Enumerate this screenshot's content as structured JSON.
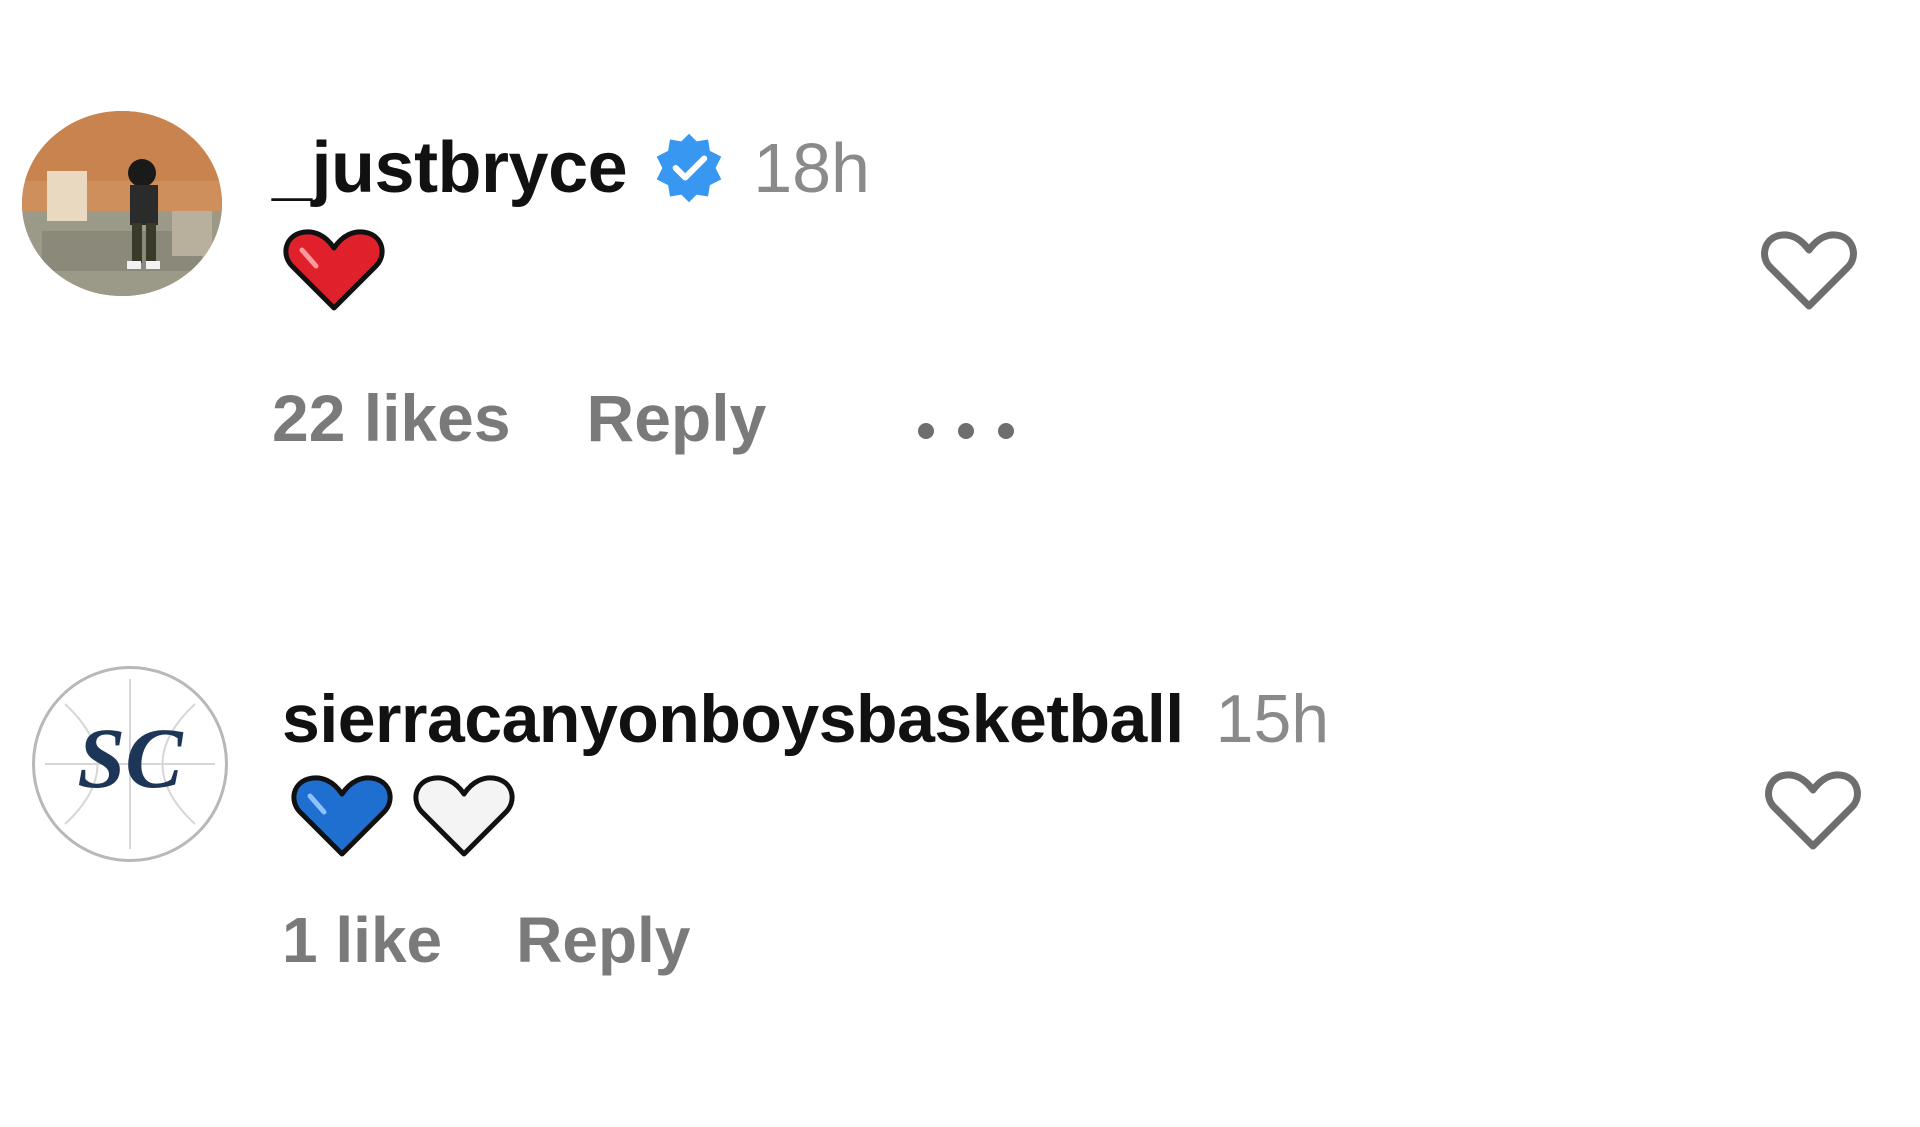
{
  "comments": [
    {
      "username": "_justbryce",
      "verified": true,
      "time": "18h",
      "emoji": [
        "red-heart"
      ],
      "likes_label": "22 likes",
      "reply_label": "Reply",
      "has_more": true,
      "avatar_icon": "photo-avatar"
    },
    {
      "username": "sierracanyonboysbasketball",
      "verified": false,
      "time": "15h",
      "emoji": [
        "blue-heart",
        "white-heart"
      ],
      "likes_label": "1 like",
      "reply_label": "Reply",
      "has_more": false,
      "avatar_icon": "sc-logo-avatar",
      "avatar_logo_text": "SC"
    }
  ],
  "colors": {
    "verified_blue": "#3897f0",
    "red_heart": "#e0202a",
    "blue_heart": "#1e6fd0",
    "muted_text": "#7a7a7a",
    "logo_navy": "#1d3557"
  }
}
